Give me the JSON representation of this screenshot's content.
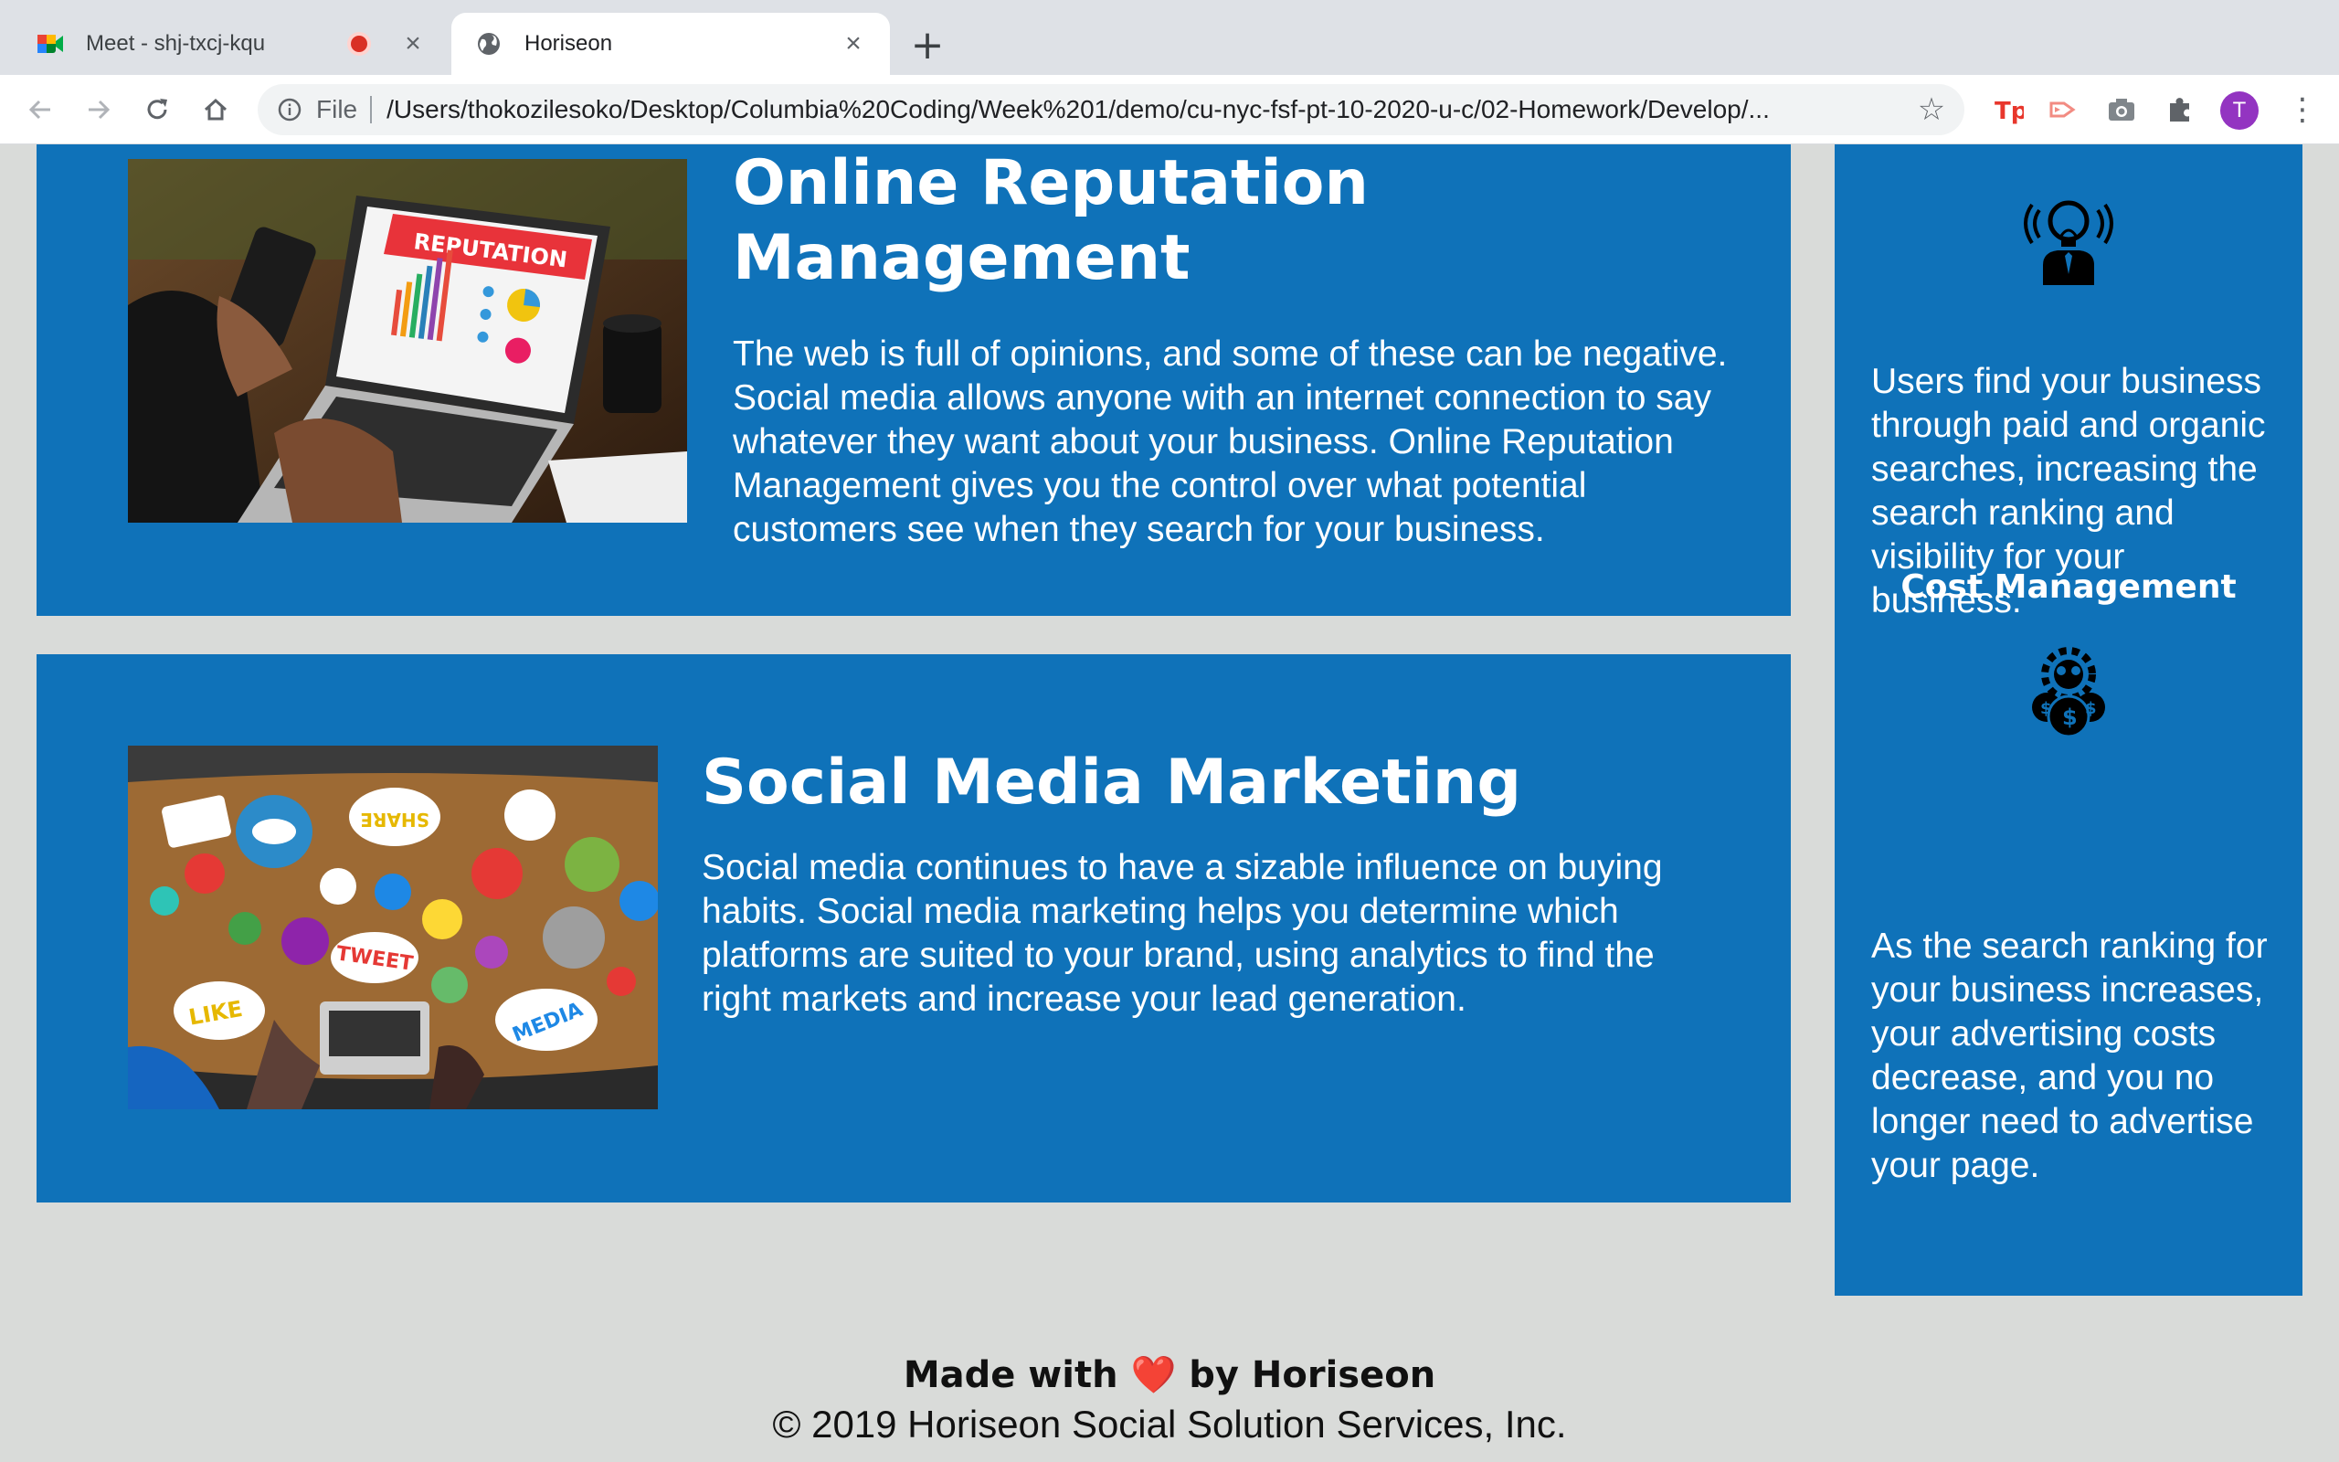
{
  "browser": {
    "tabs": [
      {
        "title": "Meet - shj-txcj-kqu",
        "active": false,
        "recording": true
      },
      {
        "title": "Horiseon",
        "active": true
      }
    ],
    "address": {
      "scheme_label": "File",
      "url": "/Users/thokozilesoko/Desktop/Columbia%20Coding/Week%201/demo/cu-nyc-fsf-pt-10-2020-u-c/02-Homework/Develop/..."
    },
    "avatar_initial": "T",
    "extensions": [
      "tp-extension-icon",
      "screencast-extension-icon",
      "camera-extension-icon",
      "puzzle-extension-icon"
    ]
  },
  "content": {
    "services": [
      {
        "title": "Online Reputation Management",
        "image_icon": "reputation-photo",
        "text": "The web is full of opinions, and some of these can be negative. Social media allows anyone with an internet connection to say whatever they want about your business. Online Reputation Management gives you the control over what potential customers see when they search for your business."
      },
      {
        "title": "Social Media Marketing",
        "image_icon": "social-media-photo",
        "text": "Social media continues to have a sizable influence on buying habits. Social media marketing helps you determine which platforms are suited to your brand, using analytics to find the right markets and increase your lead generation."
      }
    ]
  },
  "benefits": {
    "lead_text": "Users find your business through paid and organic searches, increasing the search ranking and visibility for your business.",
    "cost_title": "Cost Management",
    "cost_text": "As the search ranking for your business increases, your advertising costs decrease, and you no longer need to advertise your page."
  },
  "footer": {
    "made_prefix": "Made with",
    "heart": "❤️",
    "made_suffix": "by Horiseon",
    "copyright": "© 2019 Horiseon Social Solution Services, Inc."
  },
  "colors": {
    "brand_blue": "#0f72b9",
    "page_bg": "#d9dbd9"
  }
}
